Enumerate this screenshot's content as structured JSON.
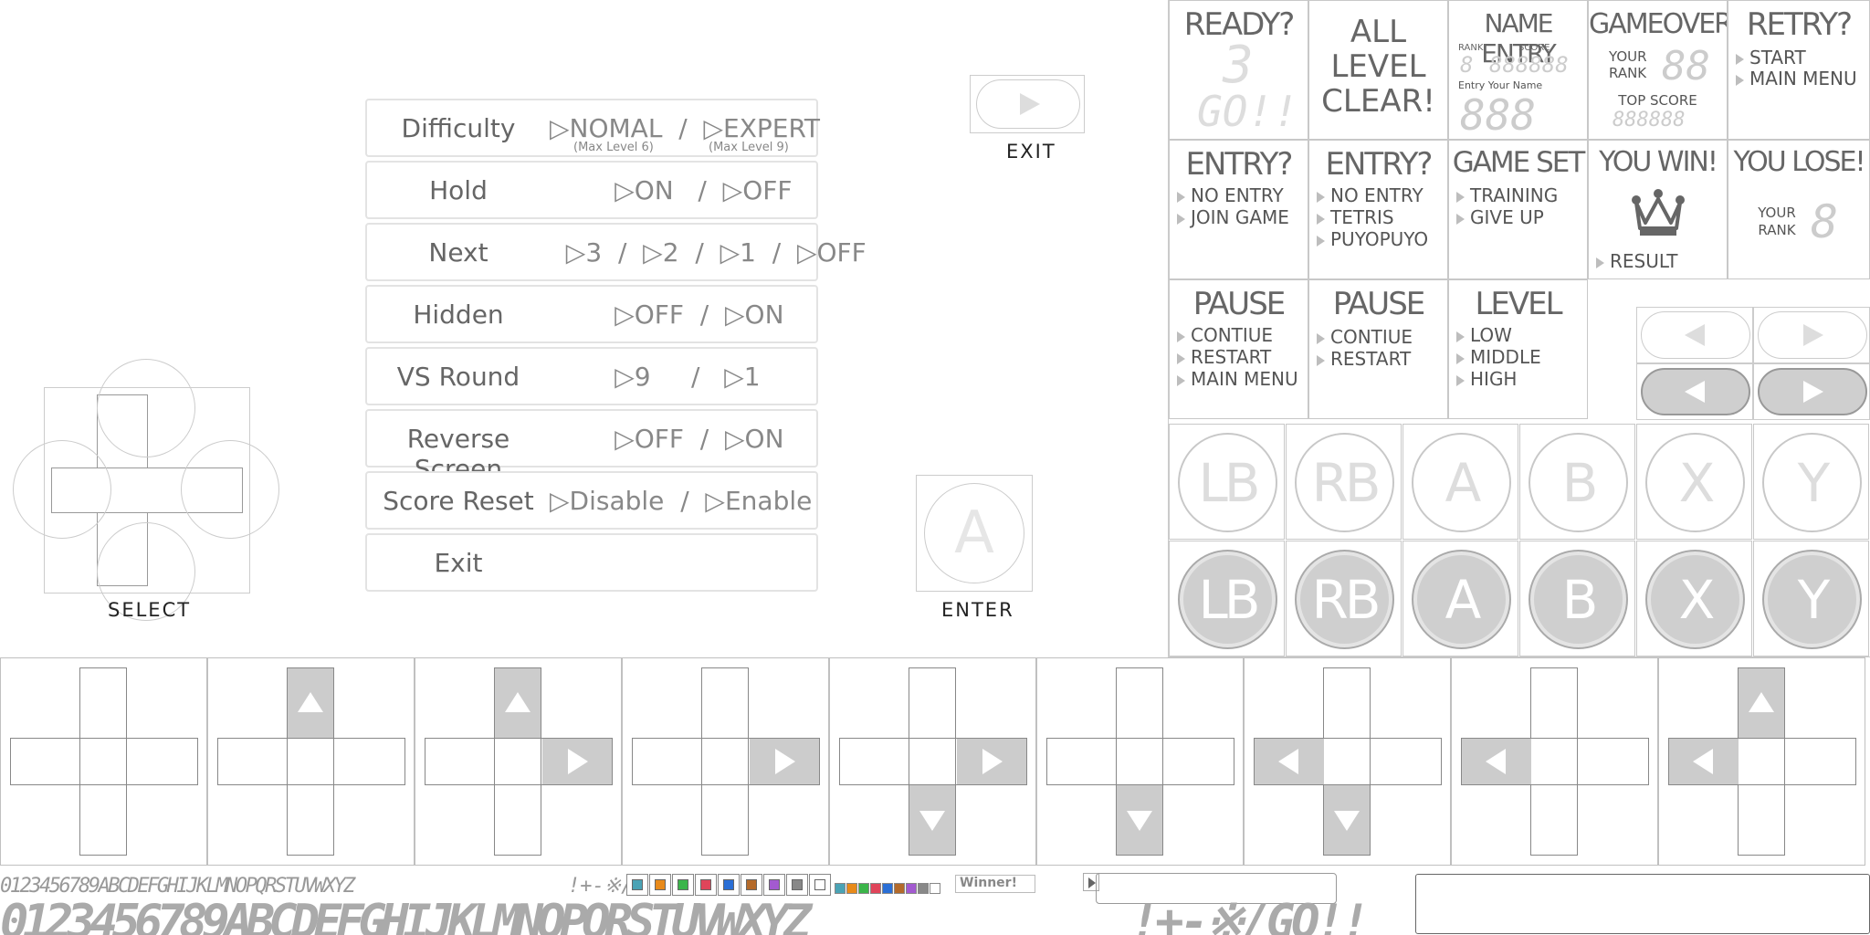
{
  "settings": {
    "rows": [
      {
        "label": "Difficulty",
        "opts": "▷NOMAL  /  ▷EXPERT",
        "sub1": "(Max Level 6)",
        "sub2": "(Max Level 9)"
      },
      {
        "label": "Hold",
        "opts": "        ▷ON   /  ▷OFF"
      },
      {
        "label": "Next",
        "opts": "  ▷3  /  ▷2  /  ▷1  /  ▷OFF"
      },
      {
        "label": "Hidden",
        "opts": "        ▷OFF  /  ▷ON"
      },
      {
        "label": "VS Round",
        "opts": "        ▷9     /   ▷1"
      },
      {
        "label": "Reverse Screen",
        "opts": "        ▷OFF  /  ▷ON"
      },
      {
        "label": "Score Reset",
        "opts": "▷Disable  /  ▷Enable"
      },
      {
        "label": "Exit",
        "opts": ""
      }
    ]
  },
  "controls": {
    "exit": "EXIT",
    "select": "SELECT",
    "enter": "ENTER",
    "enter_glyph": "A"
  },
  "panels": {
    "ready": {
      "title": "READY?",
      "digit": "3",
      "go": "GO!!"
    },
    "all_clear": {
      "line1": "ALL",
      "line2": "LEVEL",
      "line3": "CLEAR!"
    },
    "name_entry": {
      "title": "NAME ENTRY",
      "rank": "RANK",
      "score": "SCORE",
      "rank_digits": "8",
      "score_digits": "888888",
      "entry_label": "Entry Your Name",
      "name_digits": "888"
    },
    "gameover": {
      "title": "GAMEOVER",
      "your_rank": "YOUR RANK",
      "rank_digits": "88",
      "top_score": "TOP SCORE",
      "top_digits": "888888"
    },
    "retry": {
      "title": "RETRY?",
      "items": [
        "START",
        "MAIN MENU"
      ]
    },
    "entry1": {
      "title": "ENTRY?",
      "items": [
        "NO ENTRY",
        "JOIN GAME"
      ]
    },
    "entry2": {
      "title": "ENTRY?",
      "items": [
        "NO ENTRY",
        "TETRIS",
        "PUYOPUYO"
      ]
    },
    "gameset": {
      "title": "GAME SET",
      "items": [
        "TRAINING",
        "GIVE UP"
      ]
    },
    "youwin": {
      "title": "YOU WIN!",
      "items": [
        "RESULT"
      ]
    },
    "youlose": {
      "title": "YOU LOSE!",
      "your_rank": "YOUR RANK",
      "digit": "8"
    },
    "pause1": {
      "title": "PAUSE",
      "items": [
        "CONTIUE",
        "RESTART",
        "MAIN MENU"
      ]
    },
    "pause2": {
      "title": "PAUSE",
      "items": [
        "CONTIUE",
        "RESTART"
      ]
    },
    "level": {
      "title": "LEVEL",
      "items": [
        "LOW",
        "MIDDLE",
        "HIGH"
      ]
    }
  },
  "buttons": {
    "labels": [
      "LB",
      "RB",
      "A",
      "B",
      "X",
      "Y"
    ]
  },
  "font_strip": {
    "small": "0123456789ABCDEFGHIJKLMNOPQRSTUVWXYZ",
    "small_syms": "!+-※/",
    "winner": "Winner!",
    "large": "0123456789ABCDEFGHIJKLMNOPQRSTUVWXYZ",
    "large_syms": "!+-※/GO!!"
  },
  "colors": {
    "swatches": [
      "#4aa3b5",
      "#e88a1a",
      "#3bb54a",
      "#e0455a",
      "#2a6fd6",
      "#b46a2a",
      "#a35ad0",
      "#888888",
      "#ffffff"
    ]
  }
}
